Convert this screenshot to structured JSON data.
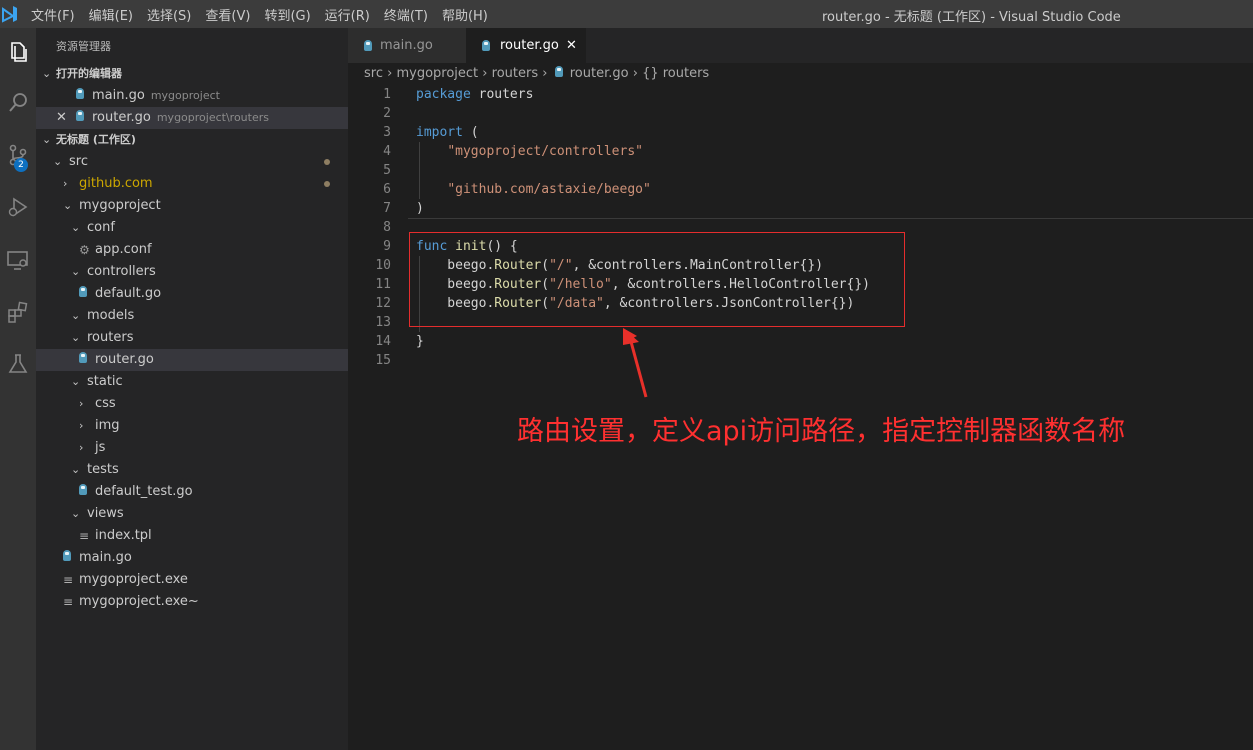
{
  "window": {
    "title": "router.go - 无标题 (工作区) - Visual Studio Code",
    "menu": [
      "文件(F)",
      "编辑(E)",
      "选择(S)",
      "查看(V)",
      "转到(G)",
      "运行(R)",
      "终端(T)",
      "帮助(H)"
    ]
  },
  "activity_bar": {
    "icons": [
      "explorer-icon",
      "search-icon",
      "source-control-icon",
      "run-debug-icon",
      "remote-explorer-icon",
      "extensions-icon",
      "testing-icon"
    ],
    "scm_badge": "2"
  },
  "sidebar": {
    "title": "资源管理器",
    "open_editors": {
      "label": "打开的编辑器",
      "items": [
        {
          "name": "main.go",
          "path": "mygoproject"
        },
        {
          "name": "router.go",
          "path": "mygoproject\\routers"
        }
      ]
    },
    "workspace": {
      "label": "无标题 (工作区)",
      "tree": [
        {
          "name": "src",
          "type": "folder",
          "depth": 0,
          "expanded": true
        },
        {
          "name": "github.com",
          "type": "folder",
          "depth": 1,
          "expanded": false
        },
        {
          "name": "mygoproject",
          "type": "folder",
          "depth": 1,
          "expanded": true
        },
        {
          "name": "conf",
          "type": "folder",
          "depth": 2,
          "expanded": true
        },
        {
          "name": "app.conf",
          "type": "conf",
          "depth": 3
        },
        {
          "name": "controllers",
          "type": "folder",
          "depth": 2,
          "expanded": true
        },
        {
          "name": "default.go",
          "type": "go",
          "depth": 3
        },
        {
          "name": "models",
          "type": "folder",
          "depth": 2,
          "expanded": true
        },
        {
          "name": "routers",
          "type": "folder",
          "depth": 2,
          "expanded": true
        },
        {
          "name": "router.go",
          "type": "go",
          "depth": 3,
          "selected": true
        },
        {
          "name": "static",
          "type": "folder",
          "depth": 2,
          "expanded": true
        },
        {
          "name": "css",
          "type": "folder",
          "depth": 3,
          "expanded": false
        },
        {
          "name": "img",
          "type": "folder",
          "depth": 3,
          "expanded": false
        },
        {
          "name": "js",
          "type": "folder",
          "depth": 3,
          "expanded": false
        },
        {
          "name": "tests",
          "type": "folder",
          "depth": 2,
          "expanded": true
        },
        {
          "name": "default_test.go",
          "type": "go",
          "depth": 3
        },
        {
          "name": "views",
          "type": "folder",
          "depth": 2,
          "expanded": true
        },
        {
          "name": "index.tpl",
          "type": "file",
          "depth": 3
        },
        {
          "name": "main.go",
          "type": "go",
          "depth": 2
        },
        {
          "name": "mygoproject.exe",
          "type": "file",
          "depth": 2
        },
        {
          "name": "mygoproject.exe~",
          "type": "file",
          "depth": 2
        }
      ]
    }
  },
  "tabs": [
    {
      "label": "main.go",
      "active": false
    },
    {
      "label": "router.go",
      "active": true,
      "close": "✕"
    }
  ],
  "breadcrumb": {
    "parts": [
      "src",
      "mygoproject",
      "routers",
      "router.go",
      "{} routers"
    ],
    "separator": "›"
  },
  "editor": {
    "lines": [
      {
        "n": "1",
        "tokens": [
          [
            "kw",
            "package"
          ],
          [
            "",
            " routers"
          ]
        ]
      },
      {
        "n": "2",
        "tokens": []
      },
      {
        "n": "3",
        "tokens": [
          [
            "kw",
            "import"
          ],
          [
            "",
            " ("
          ]
        ]
      },
      {
        "n": "4",
        "tokens": [
          [
            "",
            "    "
          ],
          [
            "str",
            "\"mygoproject/controllers\""
          ]
        ]
      },
      {
        "n": "5",
        "tokens": []
      },
      {
        "n": "6",
        "tokens": [
          [
            "",
            "    "
          ],
          [
            "str",
            "\"github.com/astaxie/beego\""
          ]
        ]
      },
      {
        "n": "7",
        "tokens": [
          [
            "",
            ")"
          ]
        ]
      },
      {
        "n": "8",
        "tokens": []
      },
      {
        "n": "9",
        "tokens": [
          [
            "kw",
            "func"
          ],
          [
            "",
            " "
          ],
          [
            "fn",
            "init"
          ],
          [
            "",
            "() {"
          ]
        ]
      },
      {
        "n": "10",
        "tokens": [
          [
            "",
            "    beego."
          ],
          [
            "fn",
            "Router"
          ],
          [
            "",
            "("
          ],
          [
            "str",
            "\"/\""
          ],
          [
            "",
            ", &controllers.MainController{})"
          ]
        ]
      },
      {
        "n": "11",
        "tokens": [
          [
            "",
            "    beego."
          ],
          [
            "fn",
            "Router"
          ],
          [
            "",
            "("
          ],
          [
            "str",
            "\"/hello\""
          ],
          [
            "",
            ", &controllers.HelloController{})"
          ]
        ]
      },
      {
        "n": "12",
        "tokens": [
          [
            "",
            "    beego."
          ],
          [
            "fn",
            "Router"
          ],
          [
            "",
            "("
          ],
          [
            "str",
            "\"/data\""
          ],
          [
            "",
            ", &controllers.JsonController{})"
          ]
        ]
      },
      {
        "n": "13",
        "tokens": []
      },
      {
        "n": "14",
        "tokens": [
          [
            "",
            "}"
          ]
        ]
      },
      {
        "n": "15",
        "tokens": []
      }
    ]
  },
  "annotation": {
    "text": "路由设置，定义api访问路径，指定控制器函数名称",
    "color": "#ff3030"
  }
}
